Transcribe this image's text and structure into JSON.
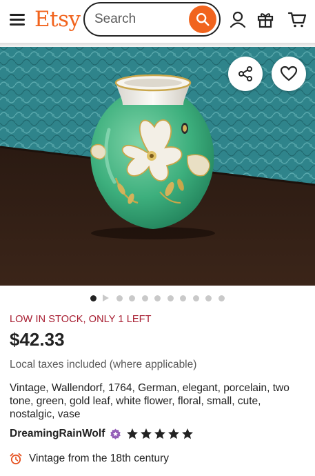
{
  "header": {
    "logo": "Etsy",
    "search_placeholder": "Search",
    "icons": [
      "menu-icon",
      "search-icon",
      "account-icon",
      "gift-icon",
      "cart-icon"
    ]
  },
  "colors": {
    "brand": "#f1641e",
    "stock_warning": "#a61a2e",
    "rating_badge": "#9560b8",
    "muted_text": "#595959"
  },
  "gallery": {
    "image_count": 10,
    "active_index": 0,
    "actions": [
      "share-icon",
      "heart-icon"
    ]
  },
  "listing": {
    "stock_notice": "LOW IN STOCK, ONLY 1 LEFT",
    "price": "$42.33",
    "tax_note": "Local taxes included (where applicable)",
    "title": "Vintage, Wallendorf, 1764, German, elegant, porcelain, two tone, green, gold leaf, white flower, floral, small, cute, nostalgic, vase",
    "shop_name": "DreamingRainWolf",
    "rating": 5,
    "rating_max": 5,
    "vintage_note": "Vintage from the 18th century"
  }
}
